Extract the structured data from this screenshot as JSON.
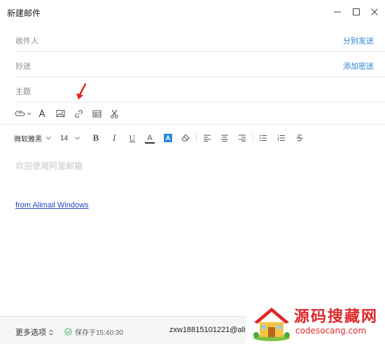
{
  "window": {
    "title": "新建邮件"
  },
  "fields": {
    "to_label": "收件人",
    "to_action": "分别发送",
    "cc_label": "抄送",
    "cc_action": "添加密送",
    "subject_label": "主题"
  },
  "toolbar1": [
    "attachment-icon",
    "font-icon",
    "image-icon",
    "link-icon",
    "table-icon",
    "screenshot-icon"
  ],
  "format": {
    "font_family": "微软雅黑",
    "font_size": "14",
    "bold": "B",
    "italic": "I",
    "underline": "U",
    "font_color": "A",
    "highlight": "A"
  },
  "body": {
    "placeholder": "欢迎使用阿里邮箱",
    "signature": "from Alimail Windows"
  },
  "footer": {
    "more_options": "更多选项",
    "saved_status": "保存于15:40:30",
    "account": "zxw18815101221@aliy"
  },
  "watermark": {
    "title": "源码搜藏网",
    "url": "codesocang.com"
  },
  "colors": {
    "link": "#2f86d6",
    "signature": "#2a46c9",
    "highlight_bg": "#2f86d6",
    "font_color_bar": "#333333",
    "annotation_arrow": "#e8201a",
    "watermark": "#e0272b",
    "saved_ok": "#3dba5a"
  }
}
